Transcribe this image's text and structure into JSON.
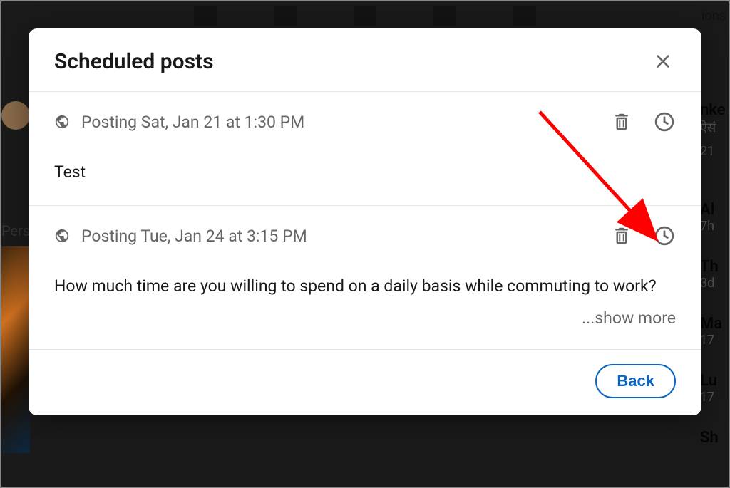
{
  "modal": {
    "title": "Scheduled posts",
    "back_label": "Back",
    "show_more_label": "...show more"
  },
  "posts": [
    {
      "schedule_text": "Posting Sat, Jan 21 at 1:30 PM",
      "content": "Test",
      "has_show_more": false
    },
    {
      "schedule_text": "Posting Tue, Jan 24 at 3:15 PM",
      "content": "How much time are you willing to spend on a daily basis while commuting to work?",
      "has_show_more": true
    }
  ],
  "background": {
    "left_text": "Pers",
    "nav_notifications": "ions",
    "right_items": [
      {
        "name": "nke",
        "sub": "ऐसं"
      },
      {
        "name": "",
        "sub": "21"
      },
      {
        "name": "Al",
        "sub": "7h"
      },
      {
        "name": "Th",
        "sub": "3d"
      },
      {
        "name": "Ma",
        "sub": "17"
      },
      {
        "name": "Lu",
        "sub": "17"
      },
      {
        "name": "Sh",
        "sub": ""
      }
    ]
  }
}
